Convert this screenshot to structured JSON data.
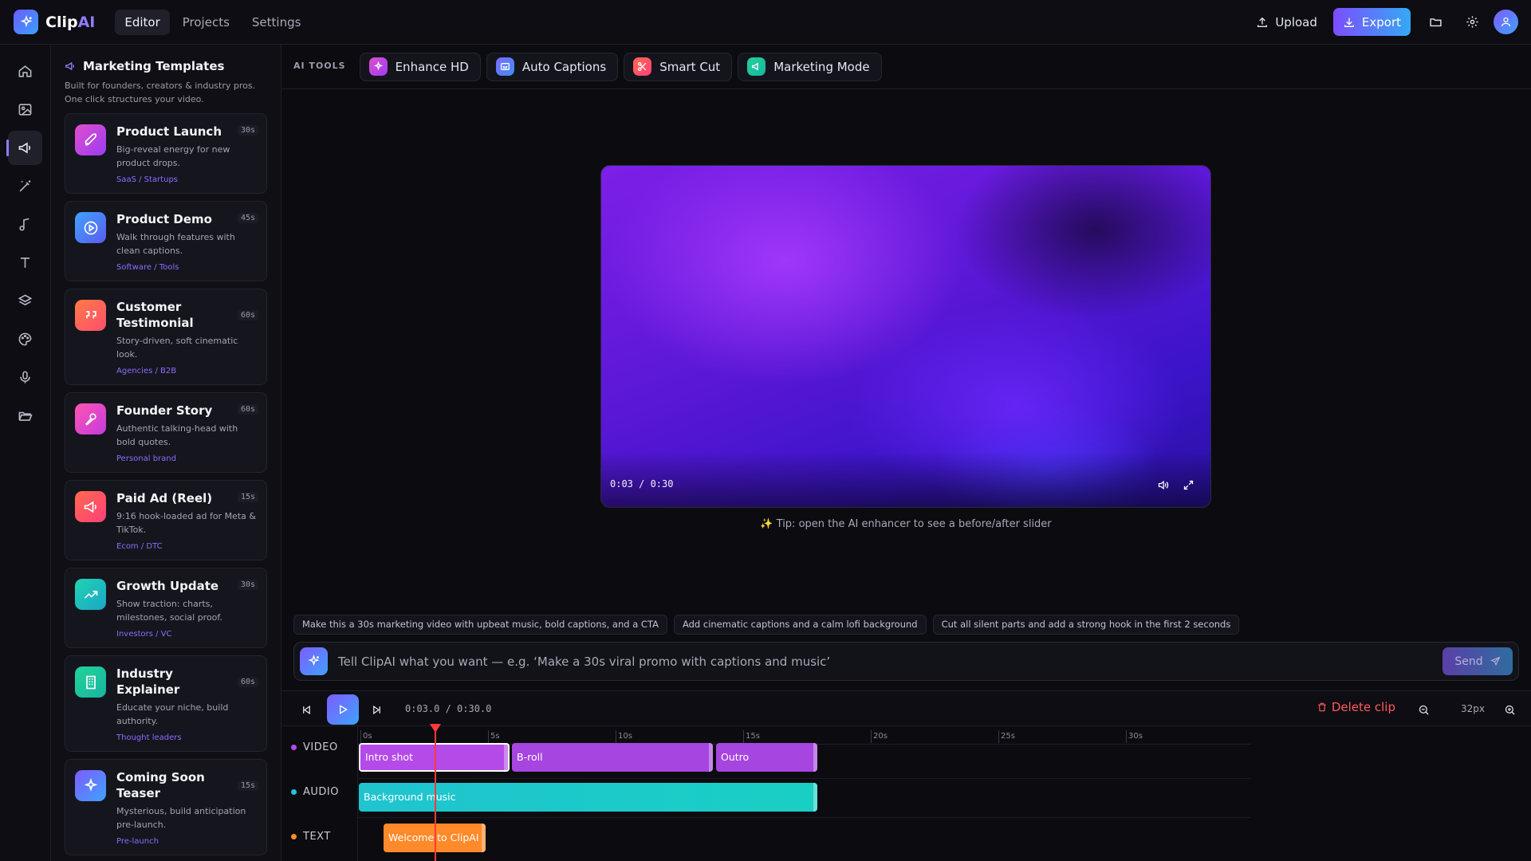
{
  "app": {
    "logo_main": "Clip",
    "logo_accent": "AI"
  },
  "nav": [
    {
      "label": "Editor",
      "active": true
    },
    {
      "label": "Projects",
      "active": false
    },
    {
      "label": "Settings",
      "active": false
    }
  ],
  "actions": {
    "upload": "Upload",
    "export": "Export"
  },
  "panel": {
    "title": "Marketing Templates",
    "subtitle_line1": "Built for founders, creators & industry pros.",
    "subtitle_line2": "One click structures your video.",
    "templates": [
      {
        "title": "Product Launch",
        "duration": "30s",
        "desc": "Big-reveal energy for new product drops.",
        "tag": "SaaS / Startups",
        "icon": "rocket-icon",
        "color": "#c24be6"
      },
      {
        "title": "Product Demo",
        "duration": "45s",
        "desc": "Walk through features with clean captions.",
        "tag": "Software / Tools",
        "icon": "play-circle-icon",
        "color": "#3d8df5"
      },
      {
        "title": "Customer Testimonial",
        "duration": "60s",
        "desc": "Story-driven, soft cinematic look.",
        "tag": "Agencies / B2B",
        "icon": "quote-icon",
        "color": "#ff6a4d"
      },
      {
        "title": "Founder Story",
        "duration": "60s",
        "desc": "Authentic talking-head with bold quotes.",
        "tag": "Personal brand",
        "icon": "mic-icon",
        "color": "#e04fcf"
      },
      {
        "title": "Paid Ad (Reel)",
        "duration": "15s",
        "desc": "9:16 hook-loaded ad for Meta & TikTok.",
        "tag": "Ecom / DTC",
        "icon": "megaphone-icon",
        "color": "#ff5a6e"
      },
      {
        "title": "Growth Update",
        "duration": "30s",
        "desc": "Show traction: charts, milestones, social proof.",
        "tag": "Investors / VC",
        "icon": "trend-up-icon",
        "color": "#1fd1b0"
      },
      {
        "title": "Industry Explainer",
        "duration": "60s",
        "desc": "Educate your niche, build authority.",
        "tag": "Thought leaders",
        "icon": "building-icon",
        "color": "#22c98e"
      },
      {
        "title": "Coming Soon Teaser",
        "duration": "15s",
        "desc": "Mysterious, build anticipation pre-launch.",
        "tag": "Pre-launch",
        "icon": "sparkle-icon",
        "color": "#6a6cff"
      }
    ]
  },
  "ai_tools": {
    "label": "AI TOOLS",
    "tools": [
      {
        "label": "Enhance HD",
        "icon": "sparkle-icon",
        "color": "#c24be6"
      },
      {
        "label": "Auto Captions",
        "icon": "captions-icon",
        "color": "#5a72ff"
      },
      {
        "label": "Smart Cut",
        "icon": "scissors-icon",
        "color": "#ff5a5a"
      },
      {
        "label": "Marketing Mode",
        "icon": "megaphone-icon",
        "color": "#1fc9a0"
      }
    ]
  },
  "preview": {
    "time": "0:03 / 0:30",
    "tip": "✨ Tip: open the AI enhancer to see a before/after slider"
  },
  "suggestions": [
    "Make this a 30s marketing video with upbeat music, bold captions, and a CTA",
    "Add cinematic captions and a calm lofi background",
    "Cut all silent parts and add a strong hook in the first 2 seconds"
  ],
  "prompt": {
    "placeholder": "Tell ClipAI what you want — e.g. ‘Make a 30s viral promo with captions and music’",
    "send": "Send"
  },
  "timeline": {
    "time": "0:03.0 / 0:30.0",
    "delete": "Delete clip",
    "zoom": "32px",
    "ruler": [
      "0s",
      "5s",
      "10s",
      "15s",
      "20s",
      "25s",
      "30s"
    ],
    "tracks": [
      {
        "name": "VIDEO",
        "color": "#b44be8"
      },
      {
        "name": "AUDIO",
        "color": "#22c4d8"
      },
      {
        "name": "TEXT",
        "color": "#ff8a2a"
      }
    ],
    "clips": {
      "video": [
        {
          "label": "Intro shot",
          "color": "#b44be8"
        },
        {
          "label": "B-roll",
          "color": "#a645e0"
        },
        {
          "label": "Outro",
          "color": "#a645e0"
        }
      ],
      "audio": [
        {
          "label": "Background music",
          "color": "#1fc4cf"
        }
      ],
      "text": [
        {
          "label": "Welcome to ClipAI",
          "color": "#ff8a2a"
        }
      ]
    }
  }
}
